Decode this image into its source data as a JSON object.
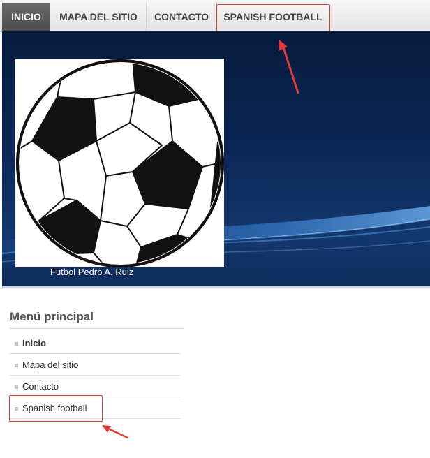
{
  "top_nav": {
    "items": [
      {
        "label": "INICIO",
        "active": true
      },
      {
        "label": "MAPA DEL SITIO",
        "active": false
      },
      {
        "label": "CONTACTO",
        "active": false
      },
      {
        "label": "SPANISH FOOTBALL",
        "active": false
      }
    ]
  },
  "banner": {
    "image_icon": "soccer-ball",
    "caption": "Futbol Pedro A. Ruiz"
  },
  "side_menu": {
    "title": "Menú principal",
    "items": [
      {
        "label": "Inicio",
        "active": true
      },
      {
        "label": "Mapa del sitio",
        "active": false
      },
      {
        "label": "Contacto",
        "active": false
      },
      {
        "label": "Spanish football",
        "active": false
      }
    ]
  },
  "colors": {
    "annotation_red": "#e23a3a",
    "nav_active_bg": "#555555",
    "banner_dark_blue": "#0e2a5c"
  }
}
